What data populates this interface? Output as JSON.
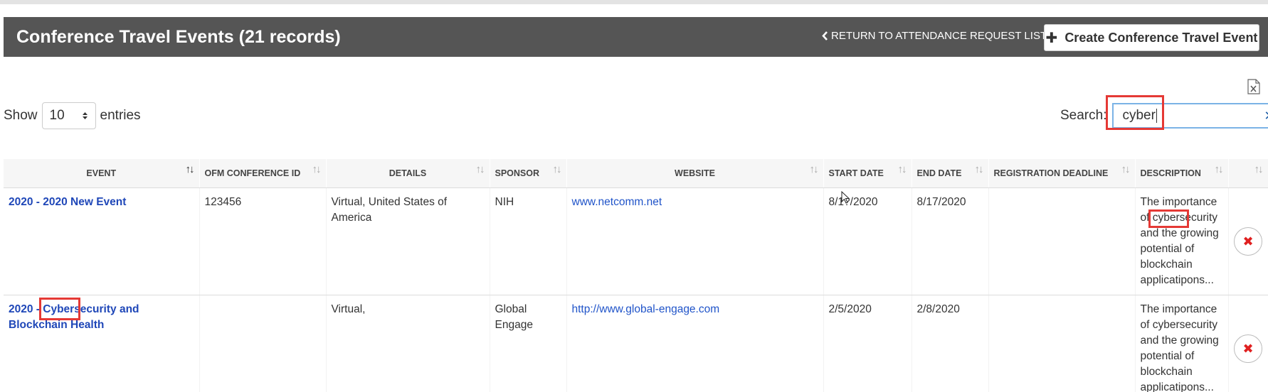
{
  "header": {
    "title": "Conference Travel Events (21 records)",
    "return_label": "RETURN TO ATTENDANCE REQUEST LIST",
    "return_icon": "chevron-left-icon",
    "create_label": "Create Conference Travel Event",
    "create_icon": "plus-icon"
  },
  "toolbar": {
    "show_label": "Show",
    "entries_value": "10",
    "entries_label": "entries",
    "search_label": "Search:",
    "search_value": "cyber",
    "clear_icon": "close-icon",
    "export_icon": "excel-file-icon"
  },
  "table": {
    "columns": [
      "EVENT",
      "OFM CONFERENCE ID",
      "DETAILS",
      "SPONSOR",
      "WEBSITE",
      "START DATE",
      "END DATE",
      "REGISTRATION DEADLINE",
      "DESCRIPTION",
      ""
    ],
    "rows": [
      {
        "event": "2020 - 2020 New Event",
        "ofm_id": "123456",
        "details": "Virtual, United States of America",
        "sponsor": "NIH",
        "website": "www.netcomm.net",
        "start": "8/1?/2020",
        "end": "8/17/2020",
        "deadline": "",
        "description": "The importance of cybersecurity and the growing potential of blockchain applicatipons..."
      },
      {
        "event": "2020 - Cybersecurity and Blockchain Health",
        "ofm_id": "",
        "details": "Virtual,",
        "sponsor": "Global Engage",
        "website": "http://www.global-engage.com",
        "start": "2/5/2020",
        "end": "2/8/2020",
        "deadline": "",
        "description": "The importance of cybersecurity and the growing potential of blockchain applicatipons..."
      }
    ]
  },
  "colors": {
    "header_bg": "#555555",
    "link": "#1f47b8",
    "highlight": "#e53935",
    "delete": "#e02020"
  }
}
